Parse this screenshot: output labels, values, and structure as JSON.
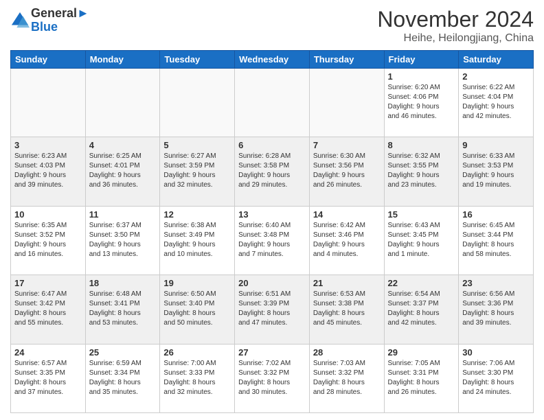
{
  "header": {
    "logo_line1": "General",
    "logo_line2": "Blue",
    "title": "November 2024",
    "subtitle": "Heihe, Heilongjiang, China"
  },
  "weekdays": [
    "Sunday",
    "Monday",
    "Tuesday",
    "Wednesday",
    "Thursday",
    "Friday",
    "Saturday"
  ],
  "weeks": [
    [
      {
        "day": "",
        "info": ""
      },
      {
        "day": "",
        "info": ""
      },
      {
        "day": "",
        "info": ""
      },
      {
        "day": "",
        "info": ""
      },
      {
        "day": "",
        "info": ""
      },
      {
        "day": "1",
        "info": "Sunrise: 6:20 AM\nSunset: 4:06 PM\nDaylight: 9 hours\nand 46 minutes."
      },
      {
        "day": "2",
        "info": "Sunrise: 6:22 AM\nSunset: 4:04 PM\nDaylight: 9 hours\nand 42 minutes."
      }
    ],
    [
      {
        "day": "3",
        "info": "Sunrise: 6:23 AM\nSunset: 4:03 PM\nDaylight: 9 hours\nand 39 minutes."
      },
      {
        "day": "4",
        "info": "Sunrise: 6:25 AM\nSunset: 4:01 PM\nDaylight: 9 hours\nand 36 minutes."
      },
      {
        "day": "5",
        "info": "Sunrise: 6:27 AM\nSunset: 3:59 PM\nDaylight: 9 hours\nand 32 minutes."
      },
      {
        "day": "6",
        "info": "Sunrise: 6:28 AM\nSunset: 3:58 PM\nDaylight: 9 hours\nand 29 minutes."
      },
      {
        "day": "7",
        "info": "Sunrise: 6:30 AM\nSunset: 3:56 PM\nDaylight: 9 hours\nand 26 minutes."
      },
      {
        "day": "8",
        "info": "Sunrise: 6:32 AM\nSunset: 3:55 PM\nDaylight: 9 hours\nand 23 minutes."
      },
      {
        "day": "9",
        "info": "Sunrise: 6:33 AM\nSunset: 3:53 PM\nDaylight: 9 hours\nand 19 minutes."
      }
    ],
    [
      {
        "day": "10",
        "info": "Sunrise: 6:35 AM\nSunset: 3:52 PM\nDaylight: 9 hours\nand 16 minutes."
      },
      {
        "day": "11",
        "info": "Sunrise: 6:37 AM\nSunset: 3:50 PM\nDaylight: 9 hours\nand 13 minutes."
      },
      {
        "day": "12",
        "info": "Sunrise: 6:38 AM\nSunset: 3:49 PM\nDaylight: 9 hours\nand 10 minutes."
      },
      {
        "day": "13",
        "info": "Sunrise: 6:40 AM\nSunset: 3:48 PM\nDaylight: 9 hours\nand 7 minutes."
      },
      {
        "day": "14",
        "info": "Sunrise: 6:42 AM\nSunset: 3:46 PM\nDaylight: 9 hours\nand 4 minutes."
      },
      {
        "day": "15",
        "info": "Sunrise: 6:43 AM\nSunset: 3:45 PM\nDaylight: 9 hours\nand 1 minute."
      },
      {
        "day": "16",
        "info": "Sunrise: 6:45 AM\nSunset: 3:44 PM\nDaylight: 8 hours\nand 58 minutes."
      }
    ],
    [
      {
        "day": "17",
        "info": "Sunrise: 6:47 AM\nSunset: 3:42 PM\nDaylight: 8 hours\nand 55 minutes."
      },
      {
        "day": "18",
        "info": "Sunrise: 6:48 AM\nSunset: 3:41 PM\nDaylight: 8 hours\nand 53 minutes."
      },
      {
        "day": "19",
        "info": "Sunrise: 6:50 AM\nSunset: 3:40 PM\nDaylight: 8 hours\nand 50 minutes."
      },
      {
        "day": "20",
        "info": "Sunrise: 6:51 AM\nSunset: 3:39 PM\nDaylight: 8 hours\nand 47 minutes."
      },
      {
        "day": "21",
        "info": "Sunrise: 6:53 AM\nSunset: 3:38 PM\nDaylight: 8 hours\nand 45 minutes."
      },
      {
        "day": "22",
        "info": "Sunrise: 6:54 AM\nSunset: 3:37 PM\nDaylight: 8 hours\nand 42 minutes."
      },
      {
        "day": "23",
        "info": "Sunrise: 6:56 AM\nSunset: 3:36 PM\nDaylight: 8 hours\nand 39 minutes."
      }
    ],
    [
      {
        "day": "24",
        "info": "Sunrise: 6:57 AM\nSunset: 3:35 PM\nDaylight: 8 hours\nand 37 minutes."
      },
      {
        "day": "25",
        "info": "Sunrise: 6:59 AM\nSunset: 3:34 PM\nDaylight: 8 hours\nand 35 minutes."
      },
      {
        "day": "26",
        "info": "Sunrise: 7:00 AM\nSunset: 3:33 PM\nDaylight: 8 hours\nand 32 minutes."
      },
      {
        "day": "27",
        "info": "Sunrise: 7:02 AM\nSunset: 3:32 PM\nDaylight: 8 hours\nand 30 minutes."
      },
      {
        "day": "28",
        "info": "Sunrise: 7:03 AM\nSunset: 3:32 PM\nDaylight: 8 hours\nand 28 minutes."
      },
      {
        "day": "29",
        "info": "Sunrise: 7:05 AM\nSunset: 3:31 PM\nDaylight: 8 hours\nand 26 minutes."
      },
      {
        "day": "30",
        "info": "Sunrise: 7:06 AM\nSunset: 3:30 PM\nDaylight: 8 hours\nand 24 minutes."
      }
    ]
  ]
}
